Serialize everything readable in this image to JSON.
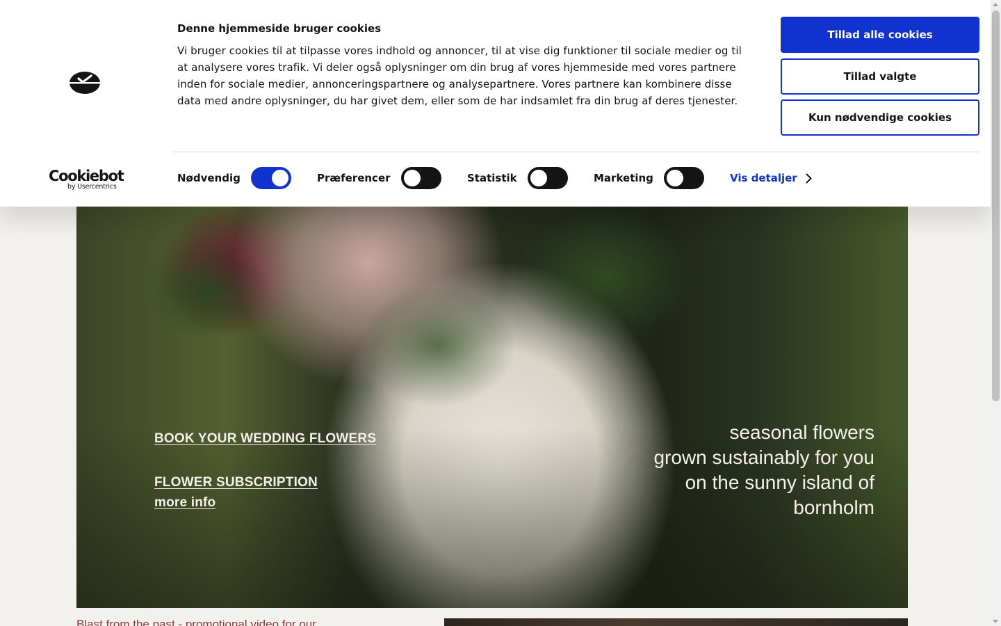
{
  "cookie_banner": {
    "title": "Denne hjemmeside bruger cookies",
    "body": "Vi bruger cookies til at tilpasse vores indhold og annoncer, til at vise dig funktioner til sociale medier og til at analysere vores trafik. Vi deler også oplysninger om din brug af vores hjemmeside med vores partnere inden for sociale medier, annonceringspartnere og analysepartnere. Vores partnere kan kombinere disse data med andre oplysninger, du har givet dem, eller som de har indsamlet fra din brug af deres tjenester.",
    "brand_name": "Cookiebot",
    "brand_sub": "by Usercentrics",
    "buttons": {
      "allow_all": "Tillad alle cookies",
      "allow_selected": "Tillad valgte",
      "necessary_only": "Kun nødvendige cookies"
    },
    "toggles": [
      {
        "label": "Nødvendig",
        "on": true
      },
      {
        "label": "Præferencer",
        "on": false
      },
      {
        "label": "Statistik",
        "on": false
      },
      {
        "label": "Marketing",
        "on": false
      }
    ],
    "details_link": "Vis detaljer",
    "accent_color": "#1032cf"
  },
  "hero": {
    "links": {
      "wedding": "BOOK YOUR WEDDING FLOWERS",
      "subscription": "FLOWER SUBSCRIPTION",
      "more_info": "more info"
    },
    "tagline": [
      "seasonal flowers",
      "grown sustainably for you",
      "on the sunny island of",
      "bornholm"
    ]
  },
  "below": {
    "blast_text": "Blast from the past - promotional video for our"
  }
}
